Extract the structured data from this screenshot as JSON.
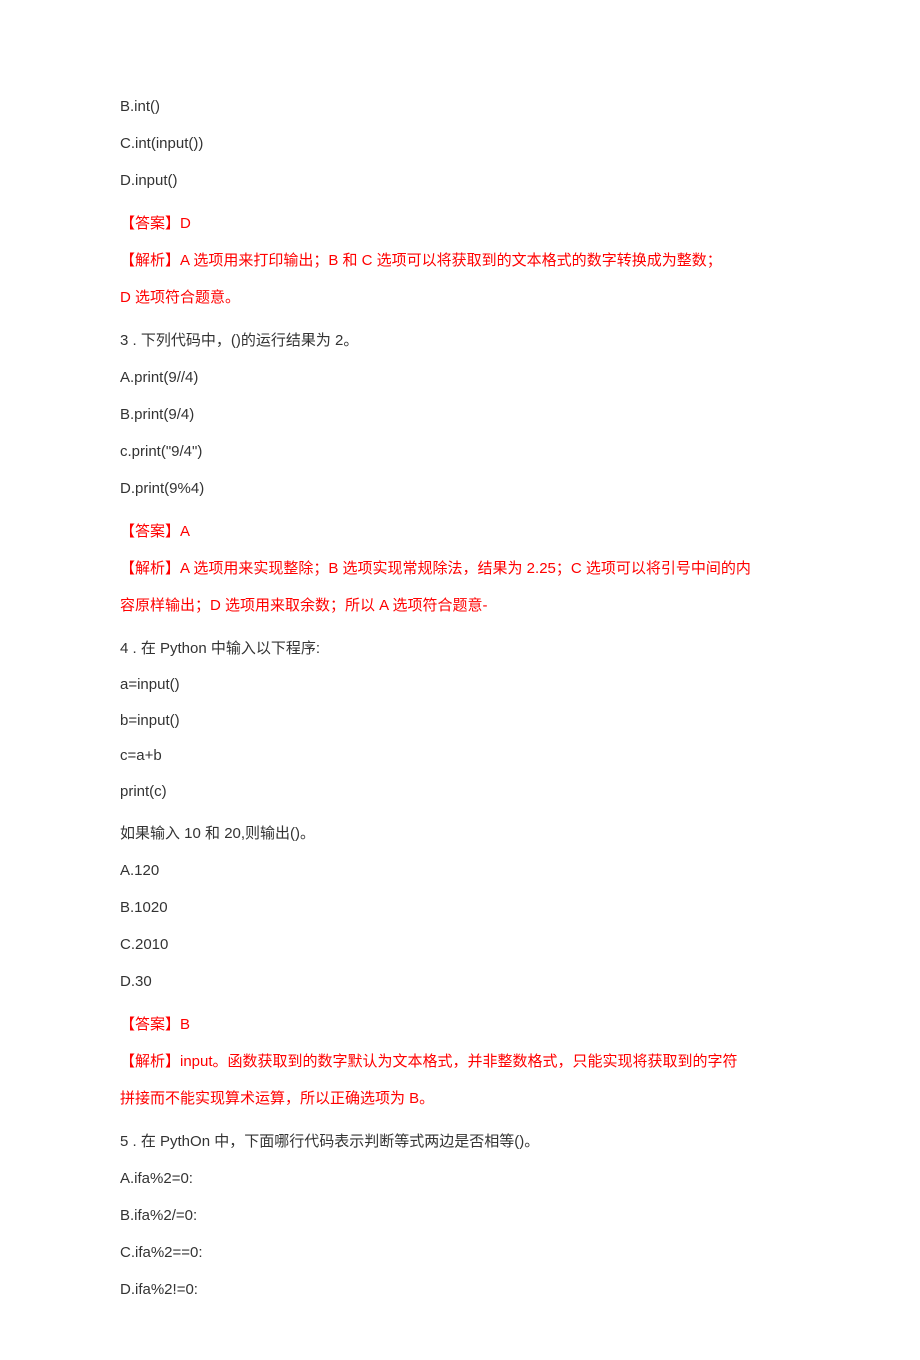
{
  "q2_opts": {
    "b": "B.int()",
    "c": "C.int(input())",
    "d": "D.input()"
  },
  "q2_answer": "【答案】D",
  "q2_explain_l1": "【解析】A 选项用来打印输出；B 和 C 选项可以将获取到的文本格式的数字转换成为整数；",
  "q2_explain_l2": "D 选项符合题意。",
  "q3_stem": "3  . 下列代码中，()的运行结果为 2。",
  "q3_opts": {
    "a": "A.print(9//4)",
    "b": "B.print(9/4)",
    "c": "c.print(\"9/4\")",
    "d": "D.print(9%4)"
  },
  "q3_answer": "【答案】A",
  "q3_explain_l1": "【解析】A 选项用来实现整除；B 选项实现常规除法，结果为 2.25；C 选项可以将引号中间的内",
  "q3_explain_l2": "容原样输出；D 选项用来取余数；所以 A 选项符合题意-",
  "q4_stem": "4  . 在 Python 中输入以下程序:",
  "q4_code": {
    "l1": "a=input()",
    "l2": "b=input()",
    "l3": "c=a+b",
    "l4": "print(c)"
  },
  "q4_after": "如果输入 10 和 20,则输出()。",
  "q4_opts": {
    "a": "A.120",
    "b": "B.1020",
    "c": "C.2010",
    "d": "D.30"
  },
  "q4_answer": "【答案】B",
  "q4_explain_l1": "【解析】input。函数获取到的数字默认为文本格式，并非整数格式，只能实现将获取到的字符",
  "q4_explain_l2": "拼接而不能实现算术运算，所以正确选项为 B。",
  "q5_stem": "5  . 在 PythOn 中，下面哪行代码表示判断等式两边是否相等()。",
  "q5_opts": {
    "a": "A.ifa%2=0:",
    "b": "B.ifa%2/=0:",
    "c": "C.ifa%2==0:",
    "d": "D.ifa%2!=0:"
  }
}
